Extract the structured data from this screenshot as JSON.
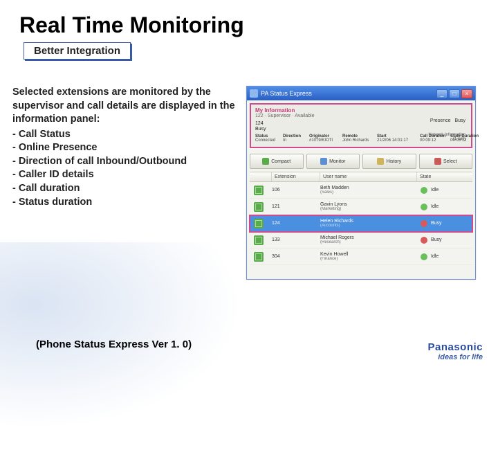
{
  "title": "Real Time Monitoring",
  "badge": "Better Integration",
  "desc_lead": "Selected extensions are monitored by the supervisor and call details are displayed in the information panel:",
  "desc_items": [
    "Call Status",
    "Online Presence",
    "Direction of call Inbound/Outbound",
    "Caller ID details",
    "Call duration",
    "Status duration"
  ],
  "version": "(Phone Status Express Ver 1. 0)",
  "brand": "Panasonic",
  "tagline": "ideas for life",
  "shot": {
    "title": "PA Status Express",
    "myinfo": "My Information",
    "subline": "122 · Supervisor · Available",
    "ext_self": "124",
    "busy": "Busy",
    "presence_label": "Presence",
    "presence_value": "Busy",
    "net_label": "Network Information",
    "net_value": "(1 call)",
    "cols": [
      "Status",
      "Direction",
      "Originator",
      "Remote",
      "Start",
      "Call Duration",
      "State Duration"
    ],
    "row": [
      "Connected",
      "In",
      "#1079/KIOTI",
      "John Richards",
      "21/2/06 14:01:17",
      "00:09:12",
      "00:03:12"
    ],
    "toolbar": [
      "Compact",
      "Monitor",
      "History",
      "Select"
    ],
    "listcols": [
      "",
      "Extension",
      "User name",
      "State"
    ],
    "exts": [
      {
        "ext": "106",
        "name": "Beth Madden",
        "dept": "(Sales)",
        "state": "Idle",
        "up": true
      },
      {
        "ext": "121",
        "name": "Gavin Lyons",
        "dept": "(Marketing)",
        "state": "Idle",
        "up": true
      },
      {
        "ext": "124",
        "name": "Helen Richards",
        "dept": "(Accounts)",
        "state": "Busy",
        "up": false
      },
      {
        "ext": "133",
        "name": "Michael Rogers",
        "dept": "(Research)",
        "state": "Busy",
        "up": false
      },
      {
        "ext": "304",
        "name": "Kevin Howell",
        "dept": "(Finance)",
        "state": "Idle",
        "up": true
      }
    ]
  }
}
